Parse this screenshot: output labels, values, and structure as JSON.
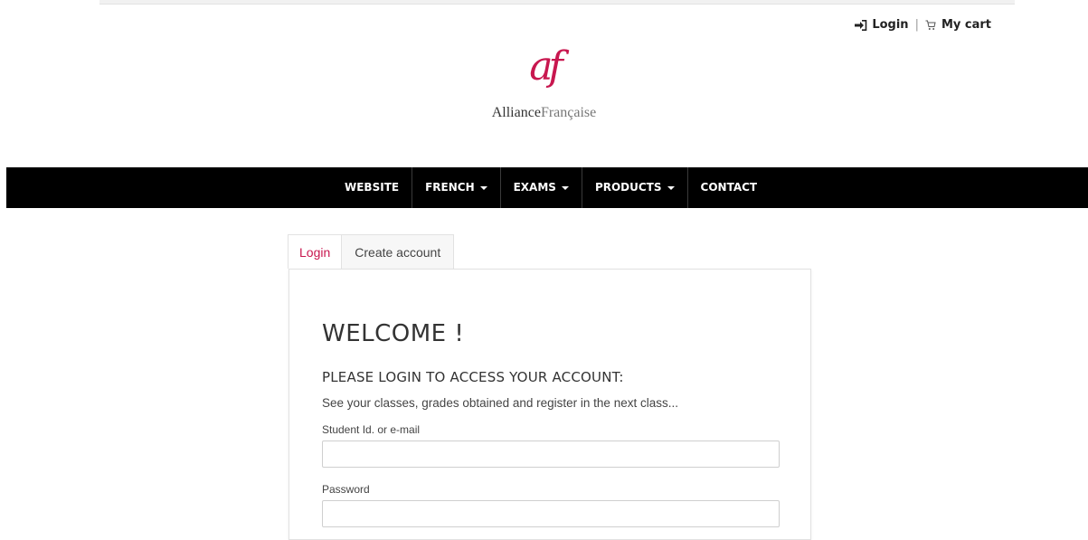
{
  "header": {
    "login_label": "Login",
    "separator": "|",
    "cart_label": "My cart"
  },
  "logo": {
    "mark": "af",
    "name_bold": "Alliance",
    "name_light": "Française"
  },
  "nav": {
    "items": [
      {
        "label": "WEBSITE",
        "has_dropdown": false
      },
      {
        "label": "FRENCH",
        "has_dropdown": true
      },
      {
        "label": "EXAMS",
        "has_dropdown": true
      },
      {
        "label": "PRODUCTS",
        "has_dropdown": true
      },
      {
        "label": "CONTACT",
        "has_dropdown": false
      }
    ]
  },
  "tabs": {
    "login": "Login",
    "create_account": "Create account",
    "active": "login"
  },
  "form": {
    "title": "WELCOME !",
    "subtitle": "PLEASE LOGIN TO ACCESS YOUR ACCOUNT:",
    "description": "See your classes, grades obtained and register in the next class...",
    "username_label": "Student Id. or e-mail",
    "username_value": "",
    "password_label": "Password",
    "password_value": ""
  },
  "colors": {
    "accent": "#c8174f",
    "navbar_bg": "#000000",
    "text": "#333333"
  },
  "icons": {
    "login": "sign-in-icon",
    "cart": "cart-icon",
    "dropdown": "caret-down-icon"
  }
}
